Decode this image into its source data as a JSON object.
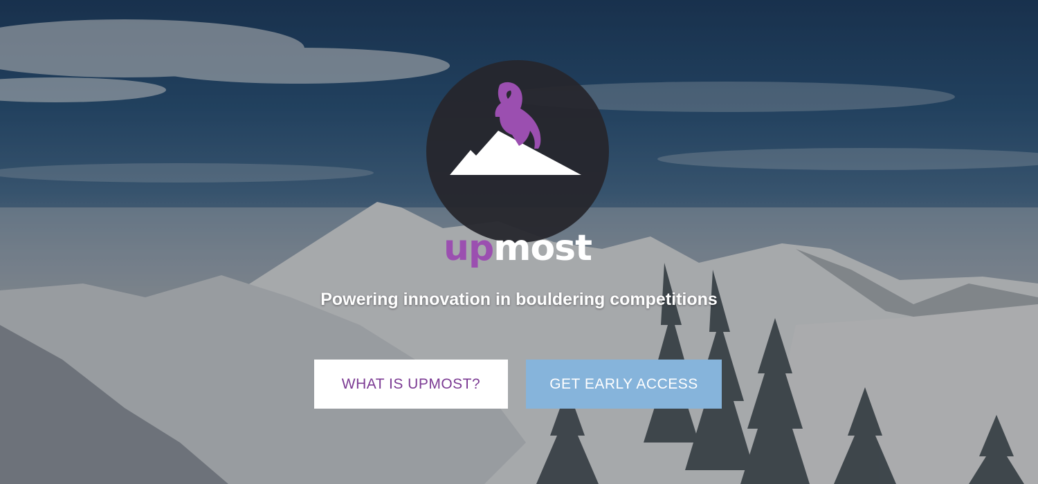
{
  "hero": {
    "background_description_icon": "snowy-mountain-landscape",
    "logo": {
      "icon": "mountain-goat-icon",
      "wordmark_part1": "up",
      "wordmark_part2": "most",
      "colors": {
        "accent": "#9b4fb0",
        "badge": "#26262c"
      }
    },
    "tagline": "Powering innovation in bouldering competitions",
    "buttons": {
      "what_label": "WHAT IS UPMOST?",
      "early_access_label": "GET EARLY ACCESS"
    },
    "colors": {
      "primary_button": "#86b4db",
      "secondary_button_text": "#7b3a93"
    }
  }
}
